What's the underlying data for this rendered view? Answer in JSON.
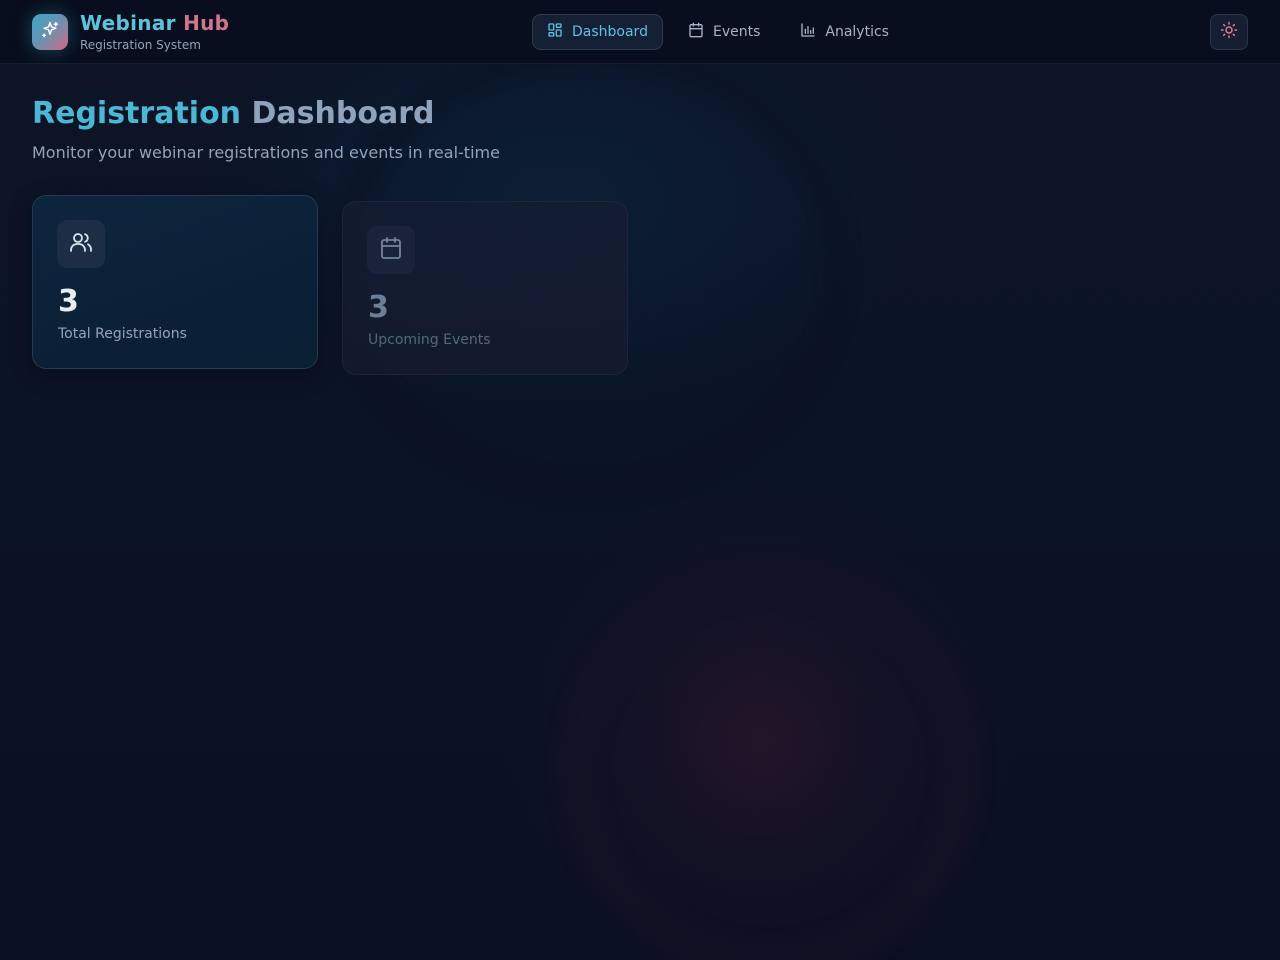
{
  "brand": {
    "title_part1": "Webinar",
    "title_part2": "Hub",
    "subtitle": "Registration System",
    "icon": "sparkles-icon"
  },
  "nav": {
    "items": [
      {
        "label": "Dashboard",
        "icon": "layout-grid-icon",
        "active": true
      },
      {
        "label": "Events",
        "icon": "calendar-icon",
        "active": false
      },
      {
        "label": "Analytics",
        "icon": "bar-chart-icon",
        "active": false
      }
    ]
  },
  "header": {
    "theme_toggle_icon": "sun-icon"
  },
  "main": {
    "title_part1": "Registration",
    "title_part2": "Dashboard",
    "subtitle": "Monitor your webinar registrations and events in real-time"
  },
  "stats": [
    {
      "value": "3",
      "label": "Total Registrations",
      "icon": "users-icon"
    },
    {
      "value": "3",
      "label": "Upcoming Events",
      "icon": "calendar-icon"
    }
  ],
  "colors": {
    "accent_cyan": "#4bb7d4",
    "accent_pink": "#d0758d",
    "background": "#0b1326"
  }
}
